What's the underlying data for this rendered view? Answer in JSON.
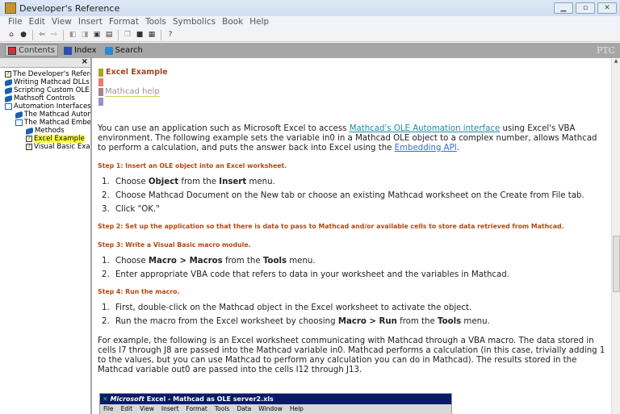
{
  "window": {
    "title": "Developer's Reference"
  },
  "menubar": [
    "File",
    "Edit",
    "View",
    "Insert",
    "Format",
    "Tools",
    "Symbolics",
    "Book",
    "Help"
  ],
  "toolbar": [
    "home-icon",
    "globe-icon",
    "back-icon",
    "forward-icon",
    "prev-page-icon",
    "next-page-icon",
    "open-topic-icon",
    "sync-icon",
    "copy-icon",
    "save-icon",
    "print-icon",
    "help-icon"
  ],
  "tabs": [
    {
      "label": "Contents"
    },
    {
      "label": "Index"
    },
    {
      "label": "Search"
    }
  ],
  "brand": "PTC",
  "tree": [
    {
      "label": "The Developer's Reference",
      "type": "page",
      "level": 0
    },
    {
      "label": "Writing Mathcad DLLs",
      "type": "book",
      "level": 0
    },
    {
      "label": "Scripting Custom OLE Objects",
      "type": "book",
      "level": 0
    },
    {
      "label": "Mathsoft Controls",
      "type": "book",
      "level": 0
    },
    {
      "label": "Automation Interfaces",
      "type": "open-book",
      "level": 0
    },
    {
      "label": "The Mathcad Automation API",
      "type": "book",
      "level": 1
    },
    {
      "label": "The Mathcad Embedding API",
      "type": "open-book",
      "level": 1
    },
    {
      "label": "Methods",
      "type": "book",
      "level": 2
    },
    {
      "label": "Excel Example",
      "type": "page",
      "level": 2,
      "selected": true
    },
    {
      "label": "Visual Basic Example",
      "type": "page",
      "level": 2
    }
  ],
  "content": {
    "title": "Excel Example",
    "help_link": "Mathcad help",
    "bar_colors": [
      "#a8a81e",
      "#f07870",
      "#a08888",
      "#9890c8"
    ],
    "intro": {
      "t1": "You can use an application such as Microsoft Excel to access ",
      "link1": "Mathcad's OLE Automation interface",
      "t2": " using Excel's VBA environment. The following example sets the variable in0 in a Mathcad OLE object to a complex number, allows Mathcad to perform a calculation, and puts the answer back into Excel using the ",
      "link2": "Embedding API",
      "t3": "."
    },
    "step1": "Step 1: Insert an OLE object into an Excel worksheet.",
    "step1_items": {
      "a1": "Choose ",
      "b1": "Object",
      "a2": " from the ",
      "b2": "Insert",
      "a3": " menu.",
      "i2": "Choose Mathcad Document on the New tab or choose an existing Mathcad worksheet on the Create from File tab.",
      "i3": "Click \"OK.\""
    },
    "step2": "Step 2: Set up the application so that there is data to pass to Mathcad and/or available cells to store data retrieved from Mathcad.",
    "step3": "Step 3: Write a Visual Basic macro module.",
    "step3_items": {
      "a1": "Choose ",
      "b1": "Macro > Macros",
      "a2": " from the ",
      "b2": "Tools",
      "a3": " menu.",
      "i2": "Enter appropriate VBA code that refers to data in your worksheet and the variables in Mathcad."
    },
    "step4": "Step 4: Run the macro.",
    "step4_items": {
      "i1": "First, double-click on the Mathcad object in the Excel worksheet to activate the object.",
      "a1": "Run the macro from the Excel worksheet by choosing ",
      "b1": "Macro > Run",
      "a2": " from the ",
      "b2": "Tools",
      "a3": " menu."
    },
    "example": "For example, the following is an Excel worksheet communicating with Mathcad through a VBA macro. The data stored in cells I7 through J8 are passed into the Mathcad variable in0. Mathcad performs a calculation (in this case, trivially adding 1 to the values, but you can use Mathcad to perform any calculation you can do in Mathcad). The results stored in the Mathcad variable out0 are passed into the cells I12 through J13.",
    "excel": {
      "brand": "Microsoft",
      "title": " Excel - Mathcad as OLE server2.xls",
      "menu": [
        "File",
        "Edit",
        "View",
        "Insert",
        "Format",
        "Tools",
        "Data",
        "Window",
        "Help"
      ]
    }
  }
}
